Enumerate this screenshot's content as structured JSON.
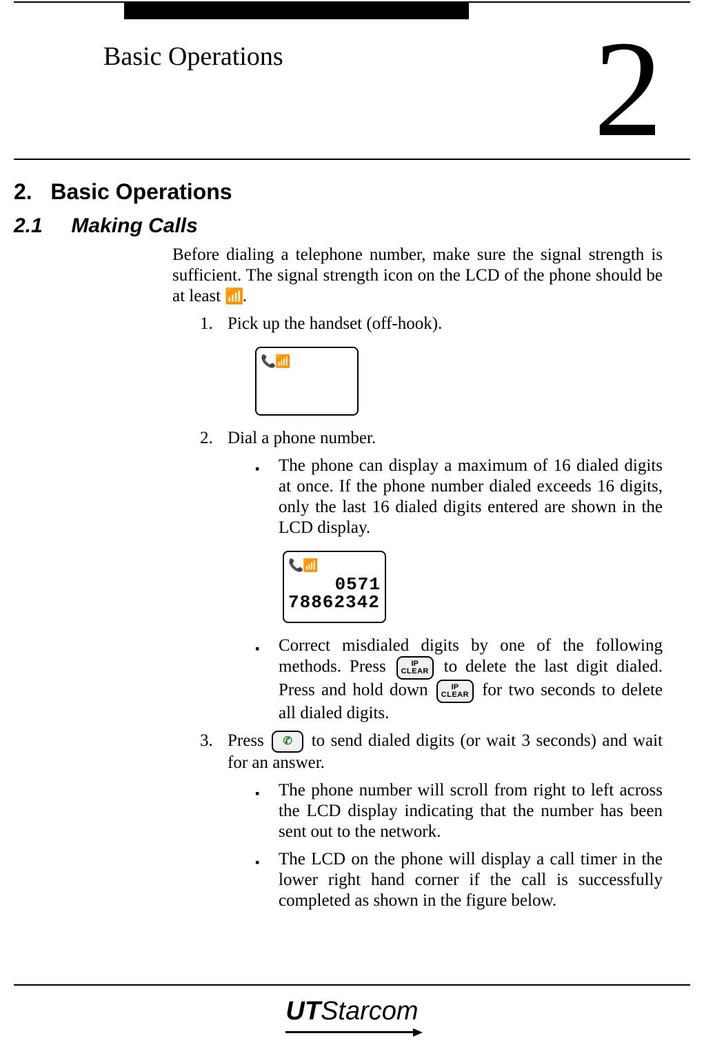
{
  "chapter": {
    "running_title": "Basic Operations",
    "number": "2"
  },
  "heading_numbered": "2.",
  "heading_text": "Basic Operations",
  "section": {
    "number": "2.1",
    "title": "Making Calls"
  },
  "intro_before": "Before dialing a telephone number, make sure the signal strength is sufficient. The signal strength icon on the LCD of the phone should be at least ",
  "intro_after": ".",
  "signal_icon_label": "signal-1-bar",
  "signal_icon_glyph": "📶",
  "steps": {
    "1": {
      "num": "1.",
      "text": "Pick up the handset (off-hook).",
      "lcd": {
        "icons": "📞📶"
      }
    },
    "2": {
      "num": "2.",
      "text": "Dial a phone number.",
      "bullet1": "The phone can display a maximum of 16 dialed digits at once. If the phone number dialed exceeds 16 digits, only the last 16 dialed digits entered are shown in the LCD display.",
      "lcd": {
        "icons": "📞📶",
        "line1": "0571",
        "line2": "78862342"
      },
      "bullet2a": "Correct misdialed digits by one of the following methods. Press ",
      "bullet2b": " to delete the last digit dialed. Press and hold down ",
      "bullet2c": " for two seconds to delete all dialed digits."
    },
    "3": {
      "num": "3.",
      "before": "Press ",
      "after": " to send dialed digits (or wait 3 seconds) and wait for an answer.",
      "bullet1": "The phone number will scroll from right to left across the LCD display indicating that the number has been sent out to the network.",
      "bullet2": "The LCD on the phone will display a call timer in the lower right hand corner if the call is successfully completed as shown in the figure below."
    }
  },
  "keys": {
    "clear": {
      "line1": "IP",
      "line2": "CLEAR"
    },
    "send": {
      "glyph": "✆"
    }
  },
  "bullet_glyph": "▪",
  "footer": {
    "logo_bold": "UT",
    "logo_rest": "Starcom"
  }
}
